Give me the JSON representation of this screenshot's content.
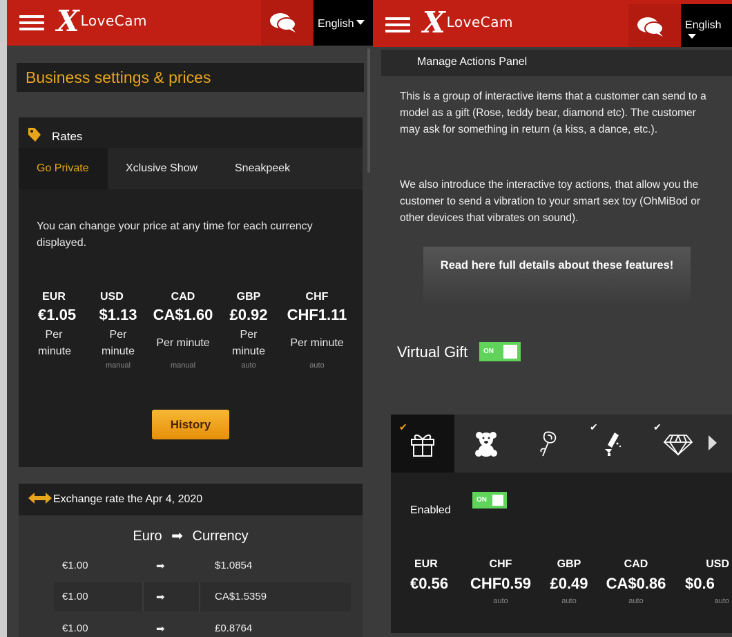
{
  "left": {
    "header": {
      "logo_x": "X",
      "logo_word": "LoveCam",
      "language": "English"
    },
    "page_title": "Business settings & prices",
    "rates": {
      "title": "Rates",
      "tabs": [
        {
          "label": "Go Private"
        },
        {
          "label": "Xclusive Show"
        },
        {
          "label": "Sneakpeek"
        }
      ],
      "note": "You can change your price at any time for each currency displayed.",
      "currencies": [
        {
          "code": "EUR",
          "value": "€1.05",
          "per": "Per minute",
          "mode": ""
        },
        {
          "code": "USD",
          "value": "$1.13",
          "per": "Per minute",
          "mode": "manual"
        },
        {
          "code": "CAD",
          "value": "CA$1.60",
          "per": "Per minute",
          "mode": "manual"
        },
        {
          "code": "GBP",
          "value": "£0.92",
          "per": "Per minute",
          "mode": "auto"
        },
        {
          "code": "CHF",
          "value": "CHF1.11",
          "per": "Per minute",
          "mode": "auto"
        }
      ],
      "history_button": "History"
    },
    "exchange": {
      "title": "Exchange rate the Apr 4, 2020",
      "subtitle_from": "Euro",
      "subtitle_arrow": "➡",
      "subtitle_to": "Currency",
      "rows": [
        {
          "from": "€1.00",
          "arrow": "➡",
          "to": "$1.0854"
        },
        {
          "from": "€1.00",
          "arrow": "➡",
          "to": "CA$1.5359"
        },
        {
          "from": "€1.00",
          "arrow": "➡",
          "to": "£0.8764"
        }
      ]
    }
  },
  "right": {
    "header": {
      "logo_x": "X",
      "logo_word": "LoveCam",
      "language": "English"
    },
    "section_title": "Manage Actions Panel",
    "para1": "This is a group of interactive items that a customer can send to a model as a gift (Rose, teddy bear, diamond etc). The customer may ask for something in return (a kiss, a dance, etc.).",
    "para2": "We also introduce the interactive toy actions, that allow you the customer to send a vibration to your smart sex toy (OhMiBod or other devices that vibrates on sound).",
    "details_button": "Read here full details about these features!",
    "virtual_gift_label": "Virtual Gift",
    "virtual_gift_toggle": "ON",
    "gift_icons": [
      {
        "icon": "gift-box-icon",
        "checked": true,
        "active": true
      },
      {
        "icon": "teddy-bear-icon",
        "checked": false,
        "active": false
      },
      {
        "icon": "rose-icon",
        "checked": false,
        "active": false
      },
      {
        "icon": "champagne-icon",
        "checked": true,
        "active": false
      },
      {
        "icon": "diamond-icon",
        "checked": true,
        "active": false
      }
    ],
    "enabled_label": "Enabled",
    "enabled_toggle": "ON",
    "prices": [
      {
        "code": "EUR",
        "value": "€0.56",
        "mode": ""
      },
      {
        "code": "CHF",
        "value": "CHF0.59",
        "mode": "auto"
      },
      {
        "code": "GBP",
        "value": "£0.49",
        "mode": "auto"
      },
      {
        "code": "CAD",
        "value": "CA$0.86",
        "mode": "auto"
      },
      {
        "code": "USD",
        "value": "$0.6",
        "mode": "auto"
      }
    ]
  },
  "colors": {
    "brand_red": "#c21f14",
    "accent_gold": "#e7a51c",
    "toggle_green": "#5fd35a",
    "panel_bg": "#3b3b3b",
    "card_bg": "#1f1f1f"
  }
}
